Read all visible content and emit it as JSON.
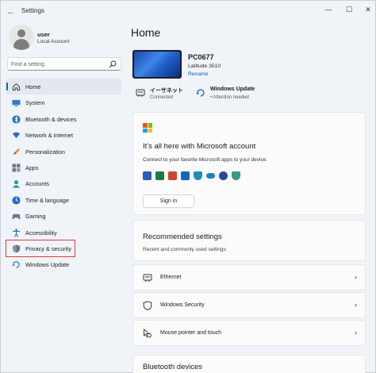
{
  "window": {
    "title": "Settings",
    "back": "←",
    "minimize": "—",
    "maximize": "☐",
    "close": "✕"
  },
  "profile": {
    "name": "user",
    "account_type": "Local Account"
  },
  "search": {
    "placeholder": "Find a setting"
  },
  "nav": {
    "items": [
      {
        "label": "Home",
        "icon": "home-icon"
      },
      {
        "label": "System",
        "icon": "system-icon"
      },
      {
        "label": "Bluetooth & devices",
        "icon": "bluetooth-icon"
      },
      {
        "label": "Network & internet",
        "icon": "network-icon"
      },
      {
        "label": "Personalization",
        "icon": "personalization-icon"
      },
      {
        "label": "Apps",
        "icon": "apps-icon"
      },
      {
        "label": "Accounts",
        "icon": "accounts-icon"
      },
      {
        "label": "Time & language",
        "icon": "time-language-icon"
      },
      {
        "label": "Gaming",
        "icon": "gaming-icon"
      },
      {
        "label": "Accessibility",
        "icon": "accessibility-icon"
      },
      {
        "label": "Privacy & security",
        "icon": "shield-icon"
      },
      {
        "label": "Windows Update",
        "icon": "update-icon"
      }
    ]
  },
  "main": {
    "title": "Home",
    "device": {
      "name": "PC0677",
      "model": "Latitude 3510",
      "rename": "Rename"
    },
    "status": {
      "ethernet": {
        "title": "イーサネット",
        "sub": "Connected"
      },
      "update": {
        "title": "Windows Update",
        "sub": "• Attention needed"
      }
    },
    "ms_card": {
      "title": "It's all here with Microsoft account",
      "description": "Connect to your favorite Microsoft apps to your device.",
      "signin": "Sign in"
    },
    "recommended": {
      "title": "Recommended settings",
      "subtitle": "Recent and commonly used settings",
      "rows": [
        {
          "label": "Ethernet",
          "icon": "ethernet-icon"
        },
        {
          "label": "Windows Security",
          "icon": "shield-icon"
        },
        {
          "label": "Mouse pointer and touch",
          "icon": "mouse-pointer-icon"
        }
      ],
      "chevron": "›"
    },
    "bluetooth_card": {
      "title": "Bluetooth devices"
    }
  },
  "colors": {
    "accent": "#0067c0",
    "highlight_box": "#d03c3c",
    "background": "#f0f4f9"
  }
}
